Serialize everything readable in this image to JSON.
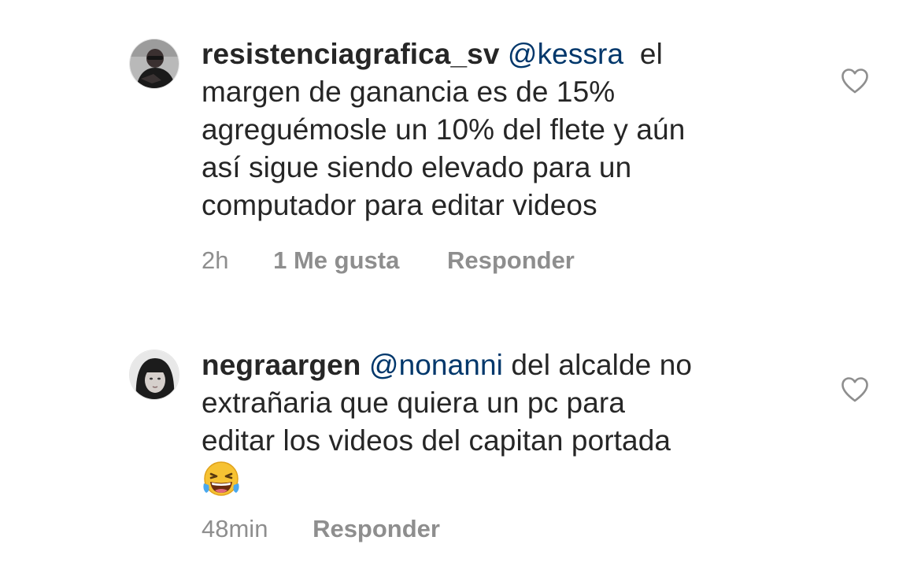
{
  "comments": [
    {
      "username": "resistenciagrafica_sv",
      "mention": "@kessra",
      "lines": [
        "el",
        "margen de ganancia es de 15%",
        "agreguémosle un 10% del flete y aún",
        "así sigue siendo elevado para un",
        "computador para editar videos"
      ],
      "time": "2h",
      "likes": "1 Me gusta",
      "reply": "Responder",
      "like_icon": "heart-outline-icon",
      "avatar_icon": "user-avatar-photo"
    },
    {
      "username": "negraargen",
      "mention": "@nonanni",
      "lines": [
        "del alcalde no",
        "extrañaria que quiera un pc para",
        "editar los videos del capitan portada"
      ],
      "emoji": "😂",
      "time": "48min",
      "reply": "Responder",
      "like_icon": "heart-outline-icon",
      "avatar_icon": "user-avatar-photo"
    }
  ],
  "colors": {
    "text": "#262626",
    "mention": "#00376b",
    "meta": "#8e8e8e",
    "icon": "#8e8e8e"
  }
}
